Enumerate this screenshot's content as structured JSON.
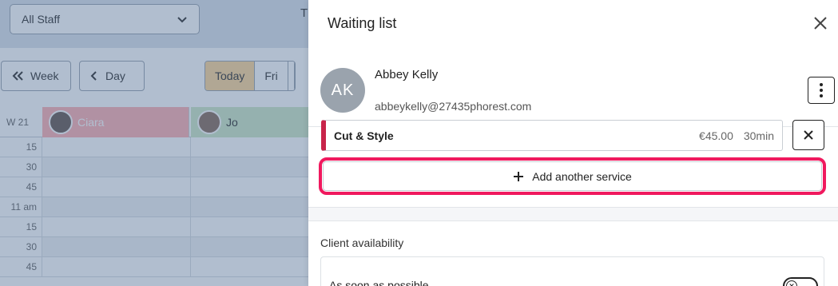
{
  "calendar": {
    "staff_filter": "All Staff",
    "header_fragment": "T",
    "nav": {
      "week_label": "Week",
      "day_label": "Day"
    },
    "days": [
      {
        "label": "Today",
        "active": true
      },
      {
        "label": "Fri",
        "active": false
      }
    ],
    "week_label": "W 21",
    "staff": [
      {
        "name": "Ciara",
        "color": "#ffb2b4"
      },
      {
        "name": "Jo",
        "color": "#cfe9c8"
      }
    ],
    "time_labels": [
      "15",
      "30",
      "45",
      "11 am",
      "15",
      "30",
      "45"
    ]
  },
  "panel": {
    "title": "Waiting list",
    "client": {
      "initials": "AK",
      "name": "Abbey Kelly",
      "email": "abbeykelly@27435phorest.com"
    },
    "service": {
      "name": "Cut & Style",
      "price": "€45.00",
      "duration": "30min",
      "color": "#c8244a"
    },
    "add_service_label": "Add another service",
    "highlight_color": "#f0195e",
    "availability": {
      "title": "Client availability",
      "asap_label": "As soon as possible",
      "asap_enabled": false
    }
  }
}
